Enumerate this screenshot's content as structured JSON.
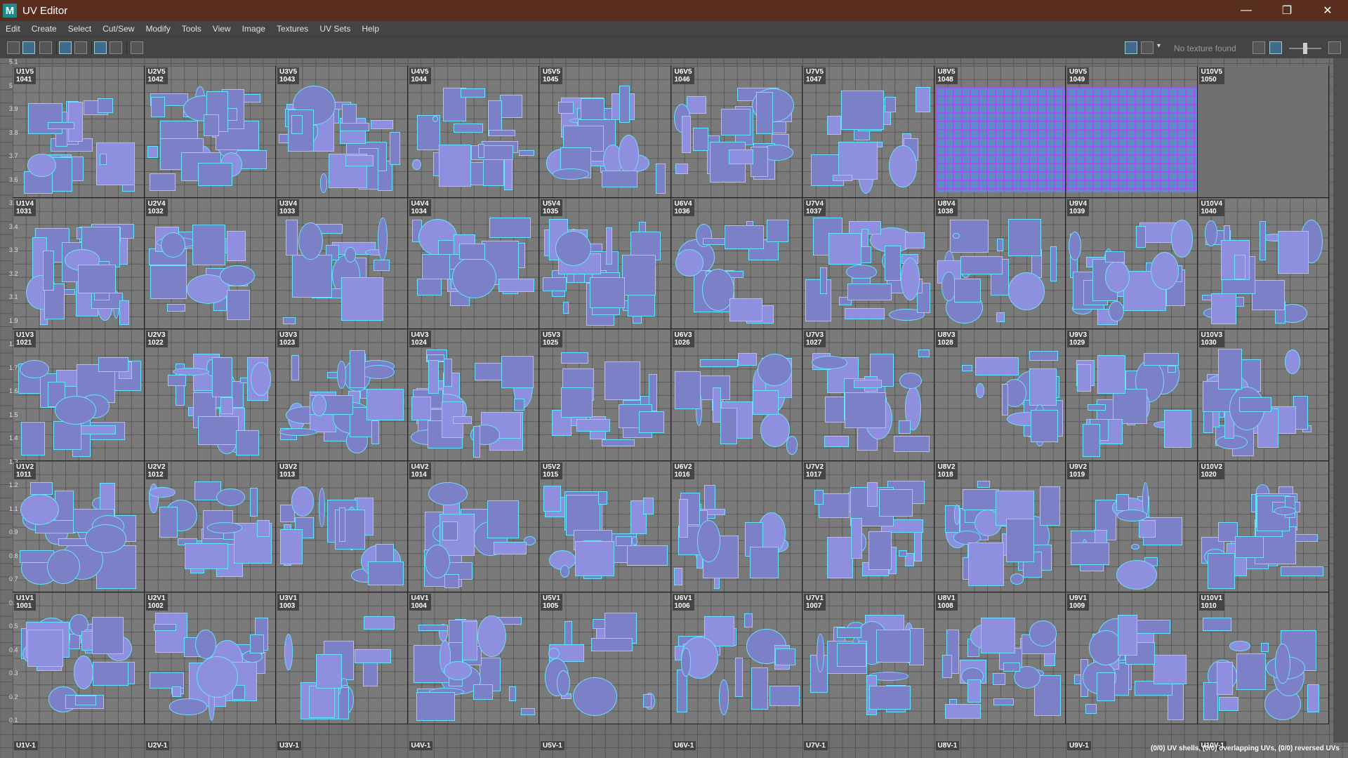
{
  "window": {
    "title": "UV Editor",
    "icon": "maya-icon",
    "controls": [
      "—",
      "❐",
      "✕"
    ]
  },
  "menu": [
    "Edit",
    "Create",
    "Select",
    "Cut/Sew",
    "Modify",
    "Tools",
    "View",
    "Image",
    "Textures",
    "UV Sets",
    "Help"
  ],
  "toolbar": {
    "texture_status": "No texture found"
  },
  "rows": [
    {
      "v": "V5",
      "tiles": [
        [
          "U1V5",
          "1041"
        ],
        [
          "U2V5",
          "1042"
        ],
        [
          "U3V5",
          "1043"
        ],
        [
          "U4V5",
          "1044"
        ],
        [
          "U5V5",
          "1045"
        ],
        [
          "U6V5",
          "1046"
        ],
        [
          "U7V5",
          "1047"
        ],
        [
          "U8V5",
          "1048"
        ],
        [
          "U9V5",
          "1049"
        ],
        [
          "U10V5",
          "1050"
        ]
      ]
    },
    {
      "v": "V4",
      "tiles": [
        [
          "U1V4",
          "1031"
        ],
        [
          "U2V4",
          "1032"
        ],
        [
          "U3V4",
          "1033"
        ],
        [
          "U4V4",
          "1034"
        ],
        [
          "U5V4",
          "1035"
        ],
        [
          "U6V4",
          "1036"
        ],
        [
          "U7V4",
          "1037"
        ],
        [
          "U8V4",
          "1038"
        ],
        [
          "U9V4",
          "1039"
        ],
        [
          "U10V4",
          "1040"
        ]
      ]
    },
    {
      "v": "V3",
      "tiles": [
        [
          "U1V3",
          "1021"
        ],
        [
          "U2V3",
          "1022"
        ],
        [
          "U3V3",
          "1023"
        ],
        [
          "U4V3",
          "1024"
        ],
        [
          "U5V3",
          "1025"
        ],
        [
          "U6V3",
          "1026"
        ],
        [
          "U7V3",
          "1027"
        ],
        [
          "U8V3",
          "1028"
        ],
        [
          "U9V3",
          "1029"
        ],
        [
          "U10V3",
          "1030"
        ]
      ]
    },
    {
      "v": "V2",
      "tiles": [
        [
          "U1V2",
          "1011"
        ],
        [
          "U2V2",
          "1012"
        ],
        [
          "U3V2",
          "1013"
        ],
        [
          "U4V2",
          "1014"
        ],
        [
          "U5V2",
          "1015"
        ],
        [
          "U6V2",
          "1016"
        ],
        [
          "U7V2",
          "1017"
        ],
        [
          "U8V2",
          "1018"
        ],
        [
          "U9V2",
          "1019"
        ],
        [
          "U10V2",
          "1020"
        ]
      ]
    },
    {
      "v": "V1",
      "tiles": [
        [
          "U1V1",
          "1001"
        ],
        [
          "U2V1",
          "1002"
        ],
        [
          "U3V1",
          "1003"
        ],
        [
          "U4V1",
          "1004"
        ],
        [
          "U5V1",
          "1005"
        ],
        [
          "U6V1",
          "1006"
        ],
        [
          "U7V1",
          "1007"
        ],
        [
          "U8V1",
          "1008"
        ],
        [
          "U9V1",
          "1009"
        ],
        [
          "U10V1",
          "1010"
        ]
      ]
    }
  ],
  "bottom_labels": [
    "U1V-1",
    "U2V-1",
    "U3V-1",
    "U4V-1",
    "U5V-1",
    "U6V-1",
    "U7V-1",
    "U8V-1",
    "U9V-1",
    "U10V-1"
  ],
  "v_ticks": [
    "5.1",
    "5",
    "3.9",
    "3.8",
    "3.7",
    "3.6",
    "3.5",
    "3.4",
    "3.3",
    "3.2",
    "3.1",
    "1.9",
    "1.8",
    "1.7",
    "1.6",
    "1.5",
    "1.4",
    "1.3",
    "1.2",
    "1.1",
    "0.9",
    "0.8",
    "0.7",
    "0.6",
    "0.5",
    "0.4",
    "0.3",
    "0.2",
    "0.1"
  ],
  "status": "(0/0) UV shells, (0/0) overlapping UVs, (0/0) reversed UVs",
  "colors": {
    "shell_fill": "#7b80c7",
    "shell_edge": "#67e3ff",
    "checker": "#b24bff",
    "titlebar": "#5a2e1e"
  }
}
